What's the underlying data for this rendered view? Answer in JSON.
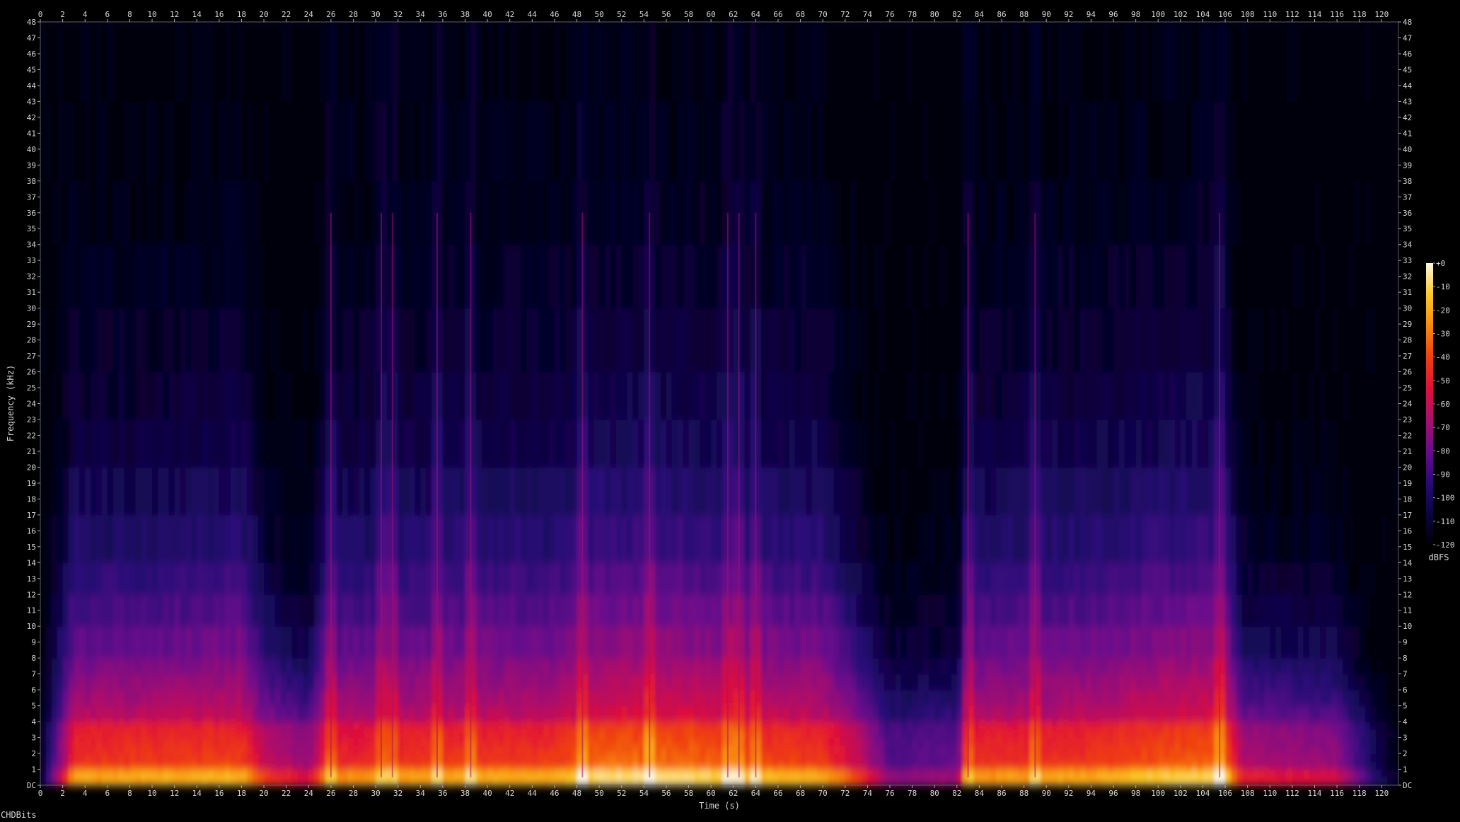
{
  "chart_data": {
    "type": "heatmap",
    "title": "",
    "xlabel": "Time (s)",
    "ylabel": "Frequency (kHz)",
    "xlim": [
      0,
      121.5
    ],
    "ylim": [
      0,
      48
    ],
    "x_ticks": [
      "0",
      "2",
      "4",
      "6",
      "8",
      "10",
      "12",
      "14",
      "16",
      "18",
      "20",
      "22",
      "24",
      "26",
      "28",
      "30",
      "32",
      "34",
      "36",
      "38",
      "40",
      "42",
      "44",
      "46",
      "48",
      "50",
      "52",
      "54",
      "56",
      "58",
      "60",
      "62",
      "64",
      "66",
      "68",
      "70",
      "72",
      "74",
      "76",
      "78",
      "80",
      "82",
      "84",
      "86",
      "88",
      "90",
      "92",
      "94",
      "96",
      "98",
      "100",
      "102",
      "104",
      "106",
      "108",
      "110",
      "112",
      "114",
      "116",
      "118",
      "120"
    ],
    "y_ticks": [
      "DC",
      "1",
      "2",
      "3",
      "4",
      "5",
      "6",
      "7",
      "8",
      "9",
      "10",
      "11",
      "12",
      "13",
      "14",
      "15",
      "16",
      "17",
      "18",
      "19",
      "20",
      "21",
      "22",
      "23",
      "24",
      "25",
      "26",
      "27",
      "28",
      "29",
      "30",
      "31",
      "32",
      "33",
      "34",
      "35",
      "36",
      "37",
      "38",
      "39",
      "40",
      "41",
      "42",
      "43",
      "44",
      "45",
      "46",
      "47",
      "48"
    ],
    "colorbar": {
      "label": "dBFS",
      "ticks": [
        "+0",
        "-10",
        "-20",
        "-30",
        "-40",
        "-50",
        "-60",
        "-70",
        "-80",
        "-90",
        "-100",
        "-110",
        "-120"
      ],
      "range": [
        -120,
        0
      ],
      "colors": [
        "#000008",
        "#0a0540",
        "#2a0a78",
        "#6a0c8c",
        "#a8106e",
        "#e0103a",
        "#f04010",
        "#f88a0c",
        "#fcc828",
        "#fff8e0"
      ]
    },
    "energy_profile": [
      {
        "t": 0,
        "intensity": 0.05,
        "bandwidth_khz": 3
      },
      {
        "t": 1,
        "intensity": 0.3,
        "bandwidth_khz": 14
      },
      {
        "t": 3,
        "intensity": 0.78,
        "bandwidth_khz": 22
      },
      {
        "t": 10,
        "intensity": 0.8,
        "bandwidth_khz": 21
      },
      {
        "t": 18,
        "intensity": 0.82,
        "bandwidth_khz": 24
      },
      {
        "t": 20,
        "intensity": 0.62,
        "bandwidth_khz": 14
      },
      {
        "t": 24,
        "intensity": 0.5,
        "bandwidth_khz": 9
      },
      {
        "t": 25.5,
        "intensity": 0.74,
        "bandwidth_khz": 22
      },
      {
        "t": 38,
        "intensity": 0.8,
        "bandwidth_khz": 24
      },
      {
        "t": 46,
        "intensity": 0.8,
        "bandwidth_khz": 24
      },
      {
        "t": 50,
        "intensity": 0.9,
        "bandwidth_khz": 26
      },
      {
        "t": 58,
        "intensity": 0.9,
        "bandwidth_khz": 25
      },
      {
        "t": 62,
        "intensity": 0.84,
        "bandwidth_khz": 25
      },
      {
        "t": 70,
        "intensity": 0.8,
        "bandwidth_khz": 24
      },
      {
        "t": 73.5,
        "intensity": 0.6,
        "bandwidth_khz": 14
      },
      {
        "t": 76,
        "intensity": 0.36,
        "bandwidth_khz": 9
      },
      {
        "t": 82,
        "intensity": 0.4,
        "bandwidth_khz": 10
      },
      {
        "t": 83,
        "intensity": 0.76,
        "bandwidth_khz": 22
      },
      {
        "t": 95,
        "intensity": 0.8,
        "bandwidth_khz": 24
      },
      {
        "t": 100,
        "intensity": 0.86,
        "bandwidth_khz": 25
      },
      {
        "t": 106,
        "intensity": 0.88,
        "bandwidth_khz": 26
      },
      {
        "t": 107.5,
        "intensity": 0.56,
        "bandwidth_khz": 12
      },
      {
        "t": 116,
        "intensity": 0.5,
        "bandwidth_khz": 11
      },
      {
        "t": 119,
        "intensity": 0.22,
        "bandwidth_khz": 4
      },
      {
        "t": 121,
        "intensity": 0.05,
        "bandwidth_khz": 2
      }
    ],
    "transients_s": [
      26,
      30.5,
      31.5,
      35.5,
      38.5,
      48.5,
      54.5,
      61.5,
      62.5,
      64,
      83,
      89,
      105.5
    ],
    "quiet_regions_s": [
      [
        24.5,
        25.5
      ],
      [
        75.5,
        82.5
      ],
      [
        107,
        121
      ]
    ]
  },
  "footer": {
    "label": "CHDBits"
  }
}
